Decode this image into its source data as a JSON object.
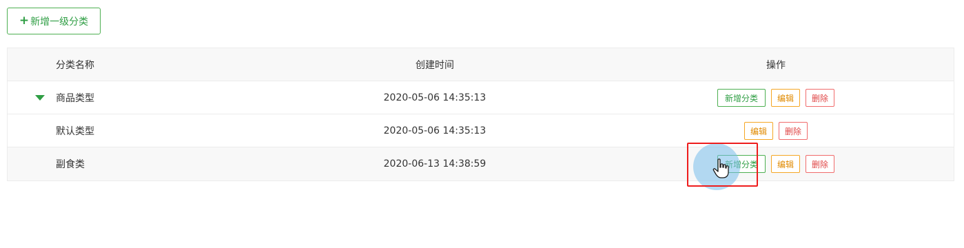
{
  "toolbar": {
    "add_top_label": "新增一级分类"
  },
  "table": {
    "headers": {
      "name": "分类名称",
      "created": "创建时间",
      "ops": "操作"
    },
    "rows": [
      {
        "name": "商品类型",
        "created": "2020-05-06 14:35:13",
        "add_label": "新增分类",
        "edit_label": "编辑",
        "delete_label": "删除"
      },
      {
        "name": "默认类型",
        "created": "2020-05-06 14:35:13",
        "edit_label": "编辑",
        "delete_label": "删除"
      },
      {
        "name": "副食类",
        "created": "2020-06-13 14:38:59",
        "add_label": "新增分类",
        "edit_label": "编辑",
        "delete_label": "删除"
      }
    ]
  },
  "colors": {
    "accent_green": "#2f9e44",
    "edit_orange": "#e08a00",
    "delete_red": "#e04848",
    "highlight_red": "#ee1c1c"
  },
  "icons": {
    "add_top": "plus-icon",
    "expand": "caret-down-icon",
    "cursor": "hand-pointer-icon"
  }
}
